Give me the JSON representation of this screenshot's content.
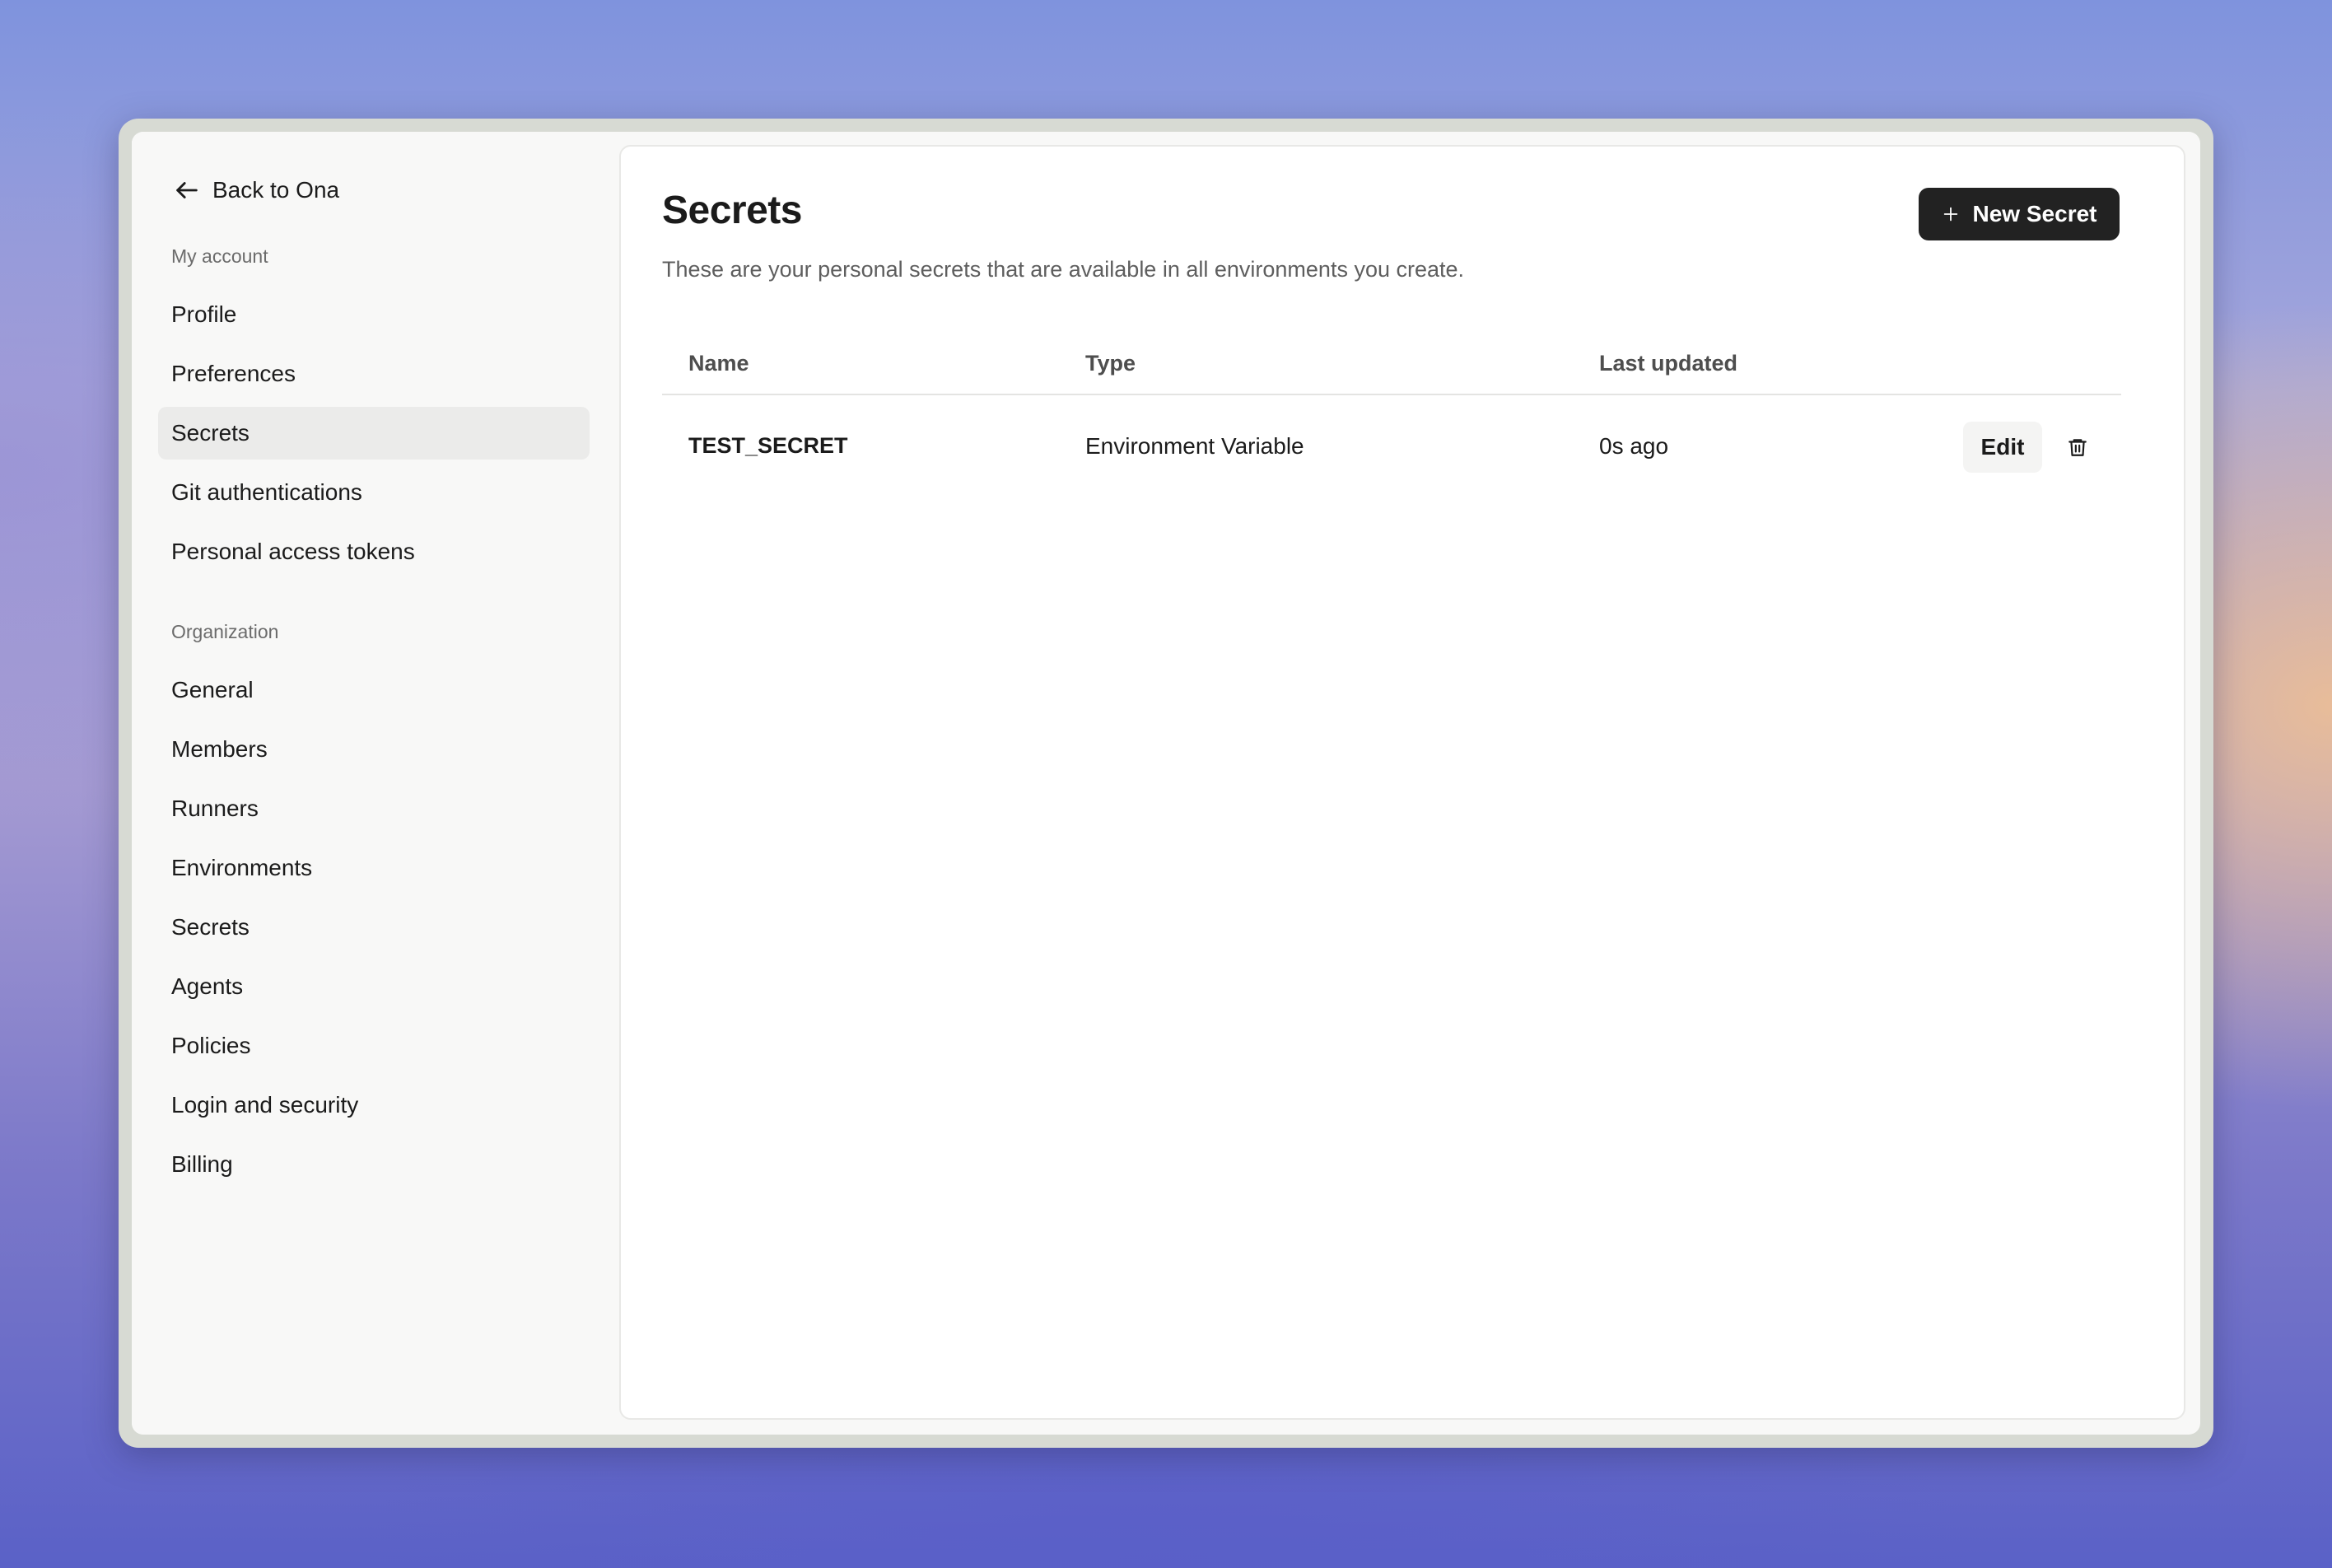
{
  "sidebar": {
    "back_label": "Back to Ona",
    "my_account_label": "My account",
    "my_account_items": [
      {
        "label": "Profile"
      },
      {
        "label": "Preferences"
      },
      {
        "label": "Secrets",
        "active": true
      },
      {
        "label": "Git authentications"
      },
      {
        "label": "Personal access tokens"
      }
    ],
    "organization_label": "Organization",
    "organization_items": [
      {
        "label": "General"
      },
      {
        "label": "Members"
      },
      {
        "label": "Runners"
      },
      {
        "label": "Environments"
      },
      {
        "label": "Secrets"
      },
      {
        "label": "Agents"
      },
      {
        "label": "Policies"
      },
      {
        "label": "Login and security"
      },
      {
        "label": "Billing"
      }
    ]
  },
  "main": {
    "title": "Secrets",
    "subtitle": "These are your personal secrets that are available in all environments you create.",
    "new_button_label": "New Secret",
    "table": {
      "columns": [
        "Name",
        "Type",
        "Last updated"
      ],
      "rows": [
        {
          "name": "TEST_SECRET",
          "type": "Environment Variable",
          "last_updated": "0s ago",
          "edit_label": "Edit"
        }
      ]
    }
  },
  "icons": {
    "back": "arrow-left-icon",
    "new": "plus-icon",
    "delete": "trash-icon"
  },
  "colors": {
    "primary_button": "#222222",
    "active_nav": "#ebebea",
    "sidebar_bg": "#f8f8f7"
  }
}
